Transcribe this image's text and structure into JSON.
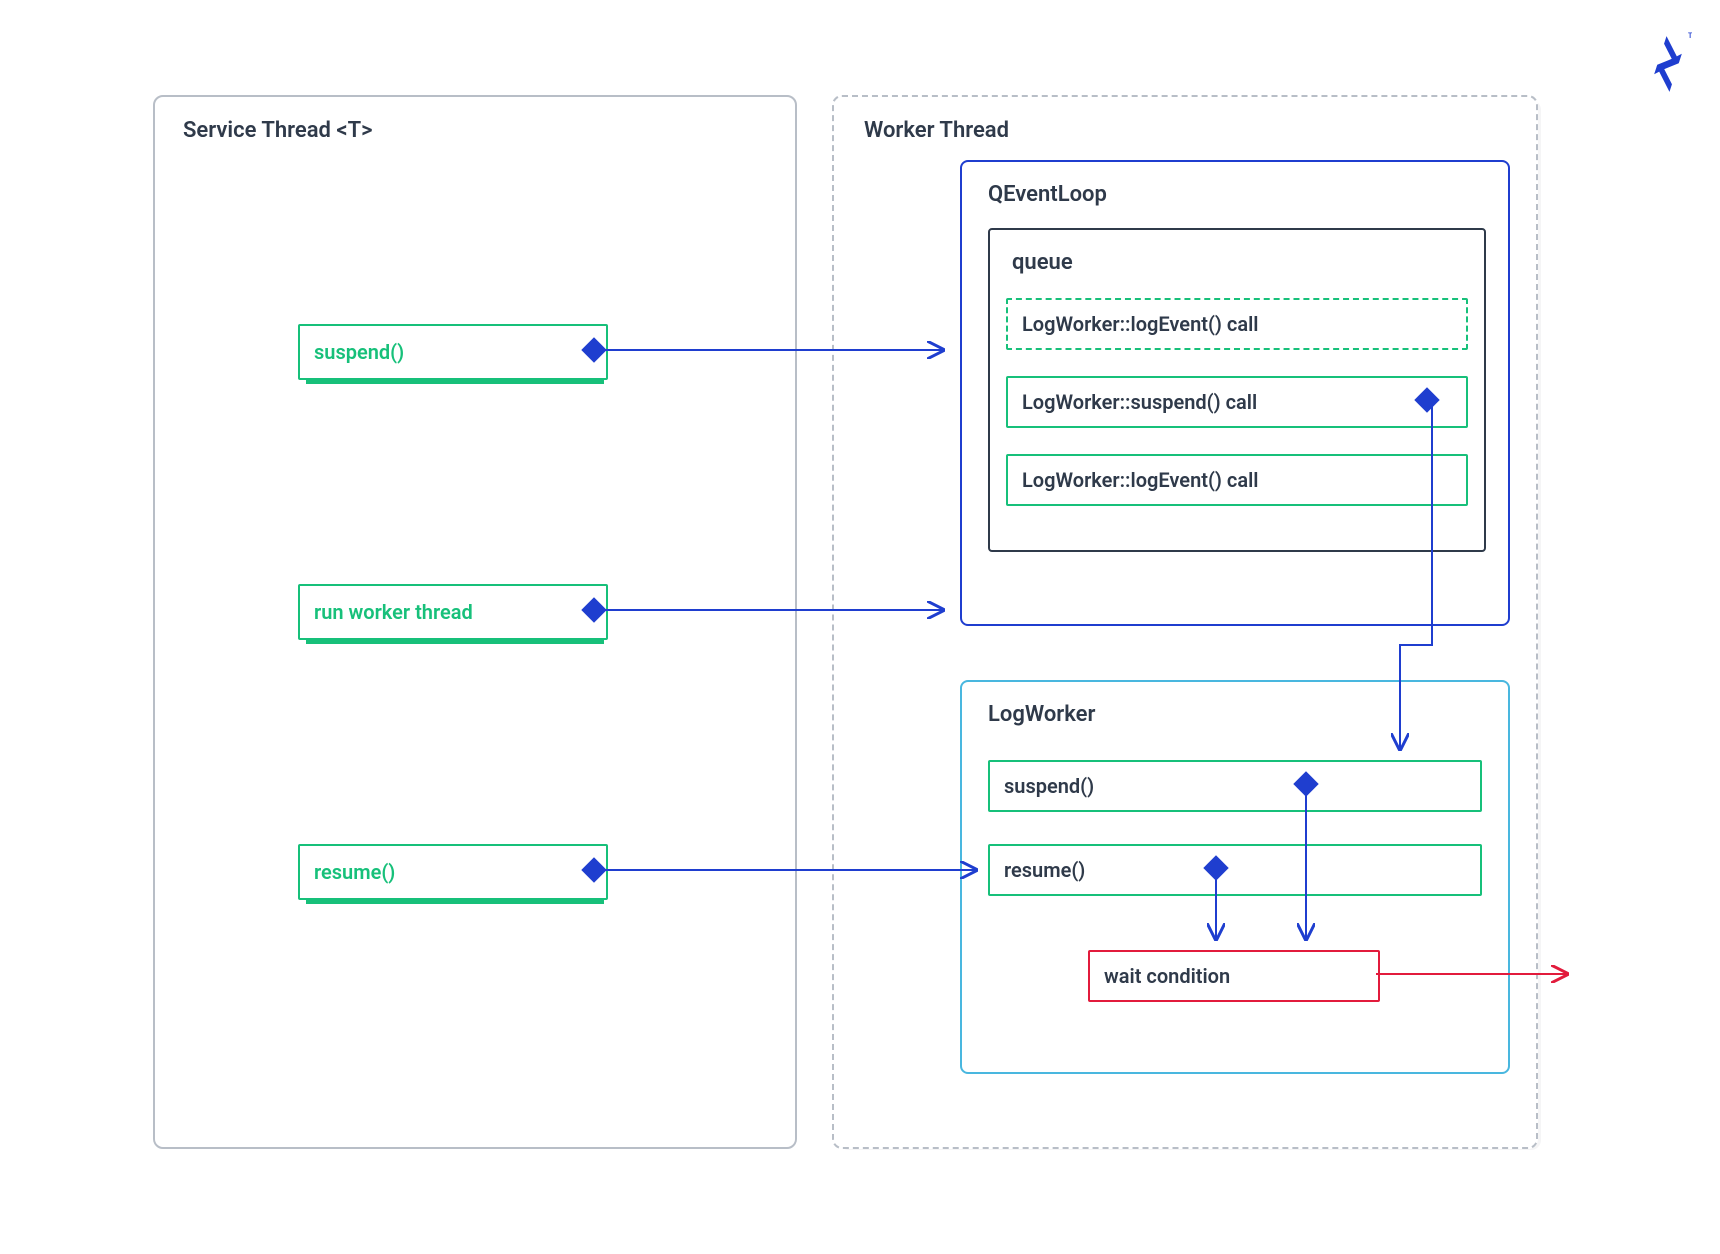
{
  "logo": {
    "name": "toptal-logo",
    "tm": "TM"
  },
  "service_thread": {
    "title": "Service Thread <T>",
    "items": [
      {
        "label": "suspend()"
      },
      {
        "label": "run worker thread"
      },
      {
        "label": "resume()"
      }
    ]
  },
  "worker_thread": {
    "title": "Worker Thread",
    "event_loop": {
      "title": "QEventLoop",
      "queue_label": "queue",
      "items": [
        {
          "label": "LogWorker::logEvent() call",
          "dashed": true
        },
        {
          "label": "LogWorker::suspend() call",
          "dashed": false,
          "emits": true
        },
        {
          "label": "LogWorker::logEvent() call",
          "dashed": false
        }
      ]
    },
    "log_worker": {
      "title": "LogWorker",
      "methods": [
        {
          "label": "suspend()"
        },
        {
          "label": "resume()"
        }
      ],
      "wait_condition": {
        "label": "wait condition"
      }
    }
  },
  "colors": {
    "green": "#17c07a",
    "blue": "#1f3ecf",
    "lightblue": "#49b7df",
    "red": "#e21b3c",
    "text": "#2f3a4a",
    "grey": "#b8bec7"
  }
}
